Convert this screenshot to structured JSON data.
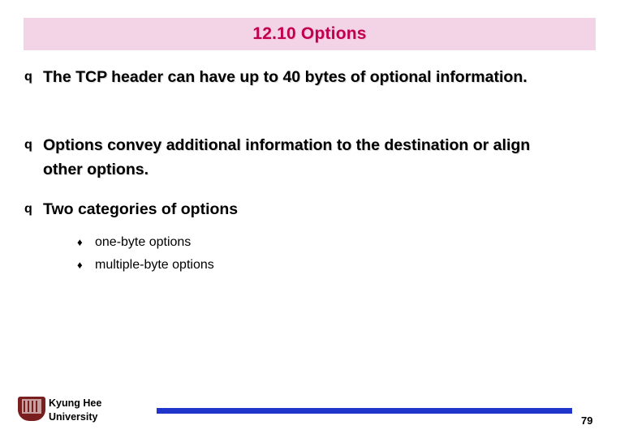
{
  "slide": {
    "title": "12.10 Options",
    "bullets": [
      {
        "marker": "q",
        "text": "The TCP header can have up to 40 bytes of optional information."
      },
      {
        "marker": "q",
        "text": "Options convey additional information to the destination or align other options."
      },
      {
        "marker": "q",
        "text": "Two categories of options"
      }
    ],
    "sub_items": [
      {
        "marker": "♦",
        "text": "one-byte options"
      },
      {
        "marker": "♦",
        "text": "multiple-byte options"
      }
    ],
    "footer": {
      "org_line1": "Kyung Hee",
      "org_line2": "University",
      "page_number": "79"
    }
  }
}
